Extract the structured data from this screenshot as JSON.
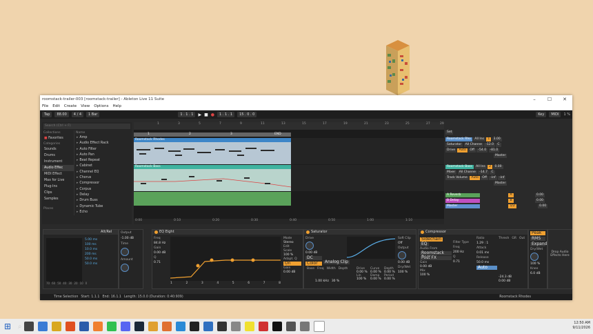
{
  "window": {
    "title": "roomstack-trailer-003 [roomstack-trailer] - Ableton Live 11 Suite",
    "menu": [
      "File",
      "Edit",
      "Create",
      "View",
      "Options",
      "Help"
    ]
  },
  "transport": {
    "tap": "Tap",
    "tempo": "88.00",
    "sig": "4 / 4",
    "quant": "1 Bar",
    "pos": "1 . 1 . 1",
    "pos2": "1 . 1 . 1",
    "loop_end": "15 . 0 . 0",
    "key": "Key",
    "midi": "MIDI",
    "cpu": "1 %"
  },
  "browser": {
    "search_placeholder": "Search (Ctrl + F)",
    "collections_label": "Collections",
    "favorites": "Favorites",
    "categories_label": "Categories",
    "categories": [
      "Sounds",
      "Drums",
      "Instrument",
      "Audio Effec",
      "MIDI Effect",
      "Max for Live",
      "Plug-Ins",
      "Clips",
      "Samples"
    ],
    "places_label": "Places",
    "name_header": "Name",
    "items": [
      "Amp",
      "Audio Effect Rack",
      "Auto Filter",
      "Auto Pan",
      "Beat Repeat",
      "Cabinet",
      "Channel EQ",
      "Chorus",
      "Compressor",
      "Corpus",
      "Delay",
      "Drum Buss",
      "Dynamic Tube",
      "Echo"
    ]
  },
  "arrangement": {
    "ruler": [
      "1",
      "3",
      "5",
      "7",
      "9",
      "11",
      "13",
      "15",
      "17",
      "19",
      "21",
      "23",
      "25",
      "27",
      "29"
    ],
    "loop_marks": [
      "1",
      "2",
      "3",
      "END"
    ],
    "track1_clip": "Roomstack Rhodes",
    "track2_clip": "Roomstack Bass",
    "time_labels": [
      "0:00",
      "0:10",
      "0:20",
      "0:30",
      "0:40",
      "0:50",
      "1:00",
      "1:10"
    ]
  },
  "mixer": {
    "set": "Set",
    "t1": {
      "name": "Roomstack Rho",
      "input": "All Ins",
      "chan": "All Channe",
      "dev": "Saturator",
      "param": "Drive",
      "out": "Master",
      "mon": "Auto",
      "off": "Off",
      "num": "1",
      "vol": "-12.0",
      "pan": "C",
      "s1": "-54.0",
      "s2": "-81.0",
      "rt": "3.00"
    },
    "t2": {
      "name": "Roomstack Bass",
      "input": "All Ins",
      "chan": "All Channe",
      "dev": "Mixer",
      "param": "Track Volume",
      "out": "Master",
      "mon": "Auto",
      "off": "Off",
      "num": "2",
      "vol": "-14.7",
      "pan": "C",
      "s1": "-inf",
      "s2": "-inf",
      "rt": "0.00"
    },
    "returns": [
      {
        "name": "A Reverb",
        "num": "A",
        "rt": "0.00"
      },
      {
        "name": "B Delay",
        "num": "B",
        "rt": "0.00"
      },
      {
        "name": "Master",
        "num": "1/2",
        "rt": "0.00"
      }
    ]
  },
  "devices": {
    "instr": {
      "title": "Alt/Rel",
      "times": [
        "5.00 ms",
        "100 ms",
        "10.0 ms",
        "200 ms",
        "50.0 ms",
        "50.0 ms"
      ],
      "output": "Output",
      "out_val": "-1.00 dB",
      "time": "Time",
      "amount": "Amount",
      "ticks": [
        "70",
        "60",
        "50",
        "40",
        "30",
        "20",
        "10",
        "0"
      ]
    },
    "eq": {
      "title": "EQ Eight",
      "freq": "Freq",
      "freq_val": "84.8 Hz",
      "gain": "Gain",
      "gain_val": "0.00 dB",
      "q": "Q",
      "q_val": "0.71",
      "mode": "Mode",
      "mode_val": "Stereo",
      "edit": "Edit",
      "scale": "Scale",
      "scale_val": "100 %",
      "gain2": "Gain",
      "gain2_val": "0.00 dB",
      "adapt": "Adapt. Q",
      "adapt_val": "On",
      "bands": [
        "1",
        "2",
        "3",
        "4",
        "5",
        "6",
        "7",
        "8"
      ],
      "axis": [
        "100",
        "1k",
        "10k"
      ]
    },
    "sat": {
      "title": "Saturator",
      "drive": "Drive",
      "drive_val": "0.00 dB",
      "dc": "DC",
      "color": "Color",
      "type": "Analog Clip",
      "base": "Base",
      "freq": "Freq",
      "width": "Width",
      "depth": "Depth",
      "freq_val": "1.00 kHz",
      "width_val": "30 %",
      "drive2": "Drive",
      "curve": "Curve",
      "depth2": "Depth",
      "lin": "Lin",
      "damp": "Damp",
      "period": "Period",
      "output": "Output",
      "out_val": "0.00 dB",
      "softclip": "Soft Clip",
      "softclip_val": "Off",
      "drywet": "Dry/Wet",
      "dw_val": "100 %",
      "drive2_val": "0.00 %",
      "curve_val": "0.00 %",
      "depth2_val": "0.00 %",
      "lin_val": "100 %",
      "damp_val": "0.00 %",
      "period_val": "0.00 %"
    },
    "comp": {
      "title": "Compressor",
      "sidechain": "Sidechain",
      "eq": "EQ",
      "audio_from": "Audio From",
      "src": "Roomstack Bass",
      "post": "Post FX",
      "filter": "Filter Type",
      "gain": "Gain",
      "gain_val": "0.00 dB",
      "freq": "Freq",
      "freq_val": "200 Hz",
      "mix": "Mix",
      "mix_val": "100 %",
      "q": "Q",
      "q_val": "0.71",
      "ratio": "Ratio",
      "ratio_val": "1.29 : 1",
      "attack": "Attack",
      "attack_val": "0.01 ms",
      "release": "Release",
      "release_val": "50.0 ms",
      "auto": "Auto",
      "thresh": "Thresh",
      "gr": "GR",
      "out": "Out",
      "peak": "Peak",
      "rms": "RMS",
      "expand": "Expand",
      "dw": "Dry/Wet",
      "dw_val": "100 %",
      "knee": "Knee",
      "knee_val": "6.0 dB",
      "thresh_val": "-24.3 dB",
      "out_val": "0.00 dB"
    },
    "drop": "Drop Audio Effects Here"
  },
  "status": {
    "mode": "Time Selection",
    "start": "Start: 1.1.1",
    "end": "End: 16.1.1",
    "len": "Length: 15.0.0 (Duration: 0:40:909)",
    "track": "Roomstack Rhodes"
  },
  "clock": {
    "time": "12:50 AM",
    "date": "9/11/2026"
  }
}
